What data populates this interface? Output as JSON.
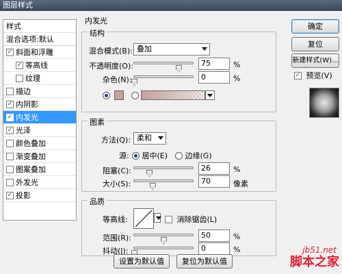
{
  "window": {
    "title": "图层样式"
  },
  "sidebar": {
    "header": "样式",
    "items": [
      {
        "label": "混合选项:默认",
        "check": false,
        "hasCheck": false
      },
      {
        "label": "斜面和浮雕",
        "check": true,
        "hasCheck": true
      },
      {
        "label": "等高线",
        "check": true,
        "hasCheck": true,
        "indent": true
      },
      {
        "label": "纹理",
        "check": false,
        "hasCheck": true,
        "indent": true
      },
      {
        "label": "描边",
        "check": false,
        "hasCheck": true
      },
      {
        "label": "内阴影",
        "check": true,
        "hasCheck": true
      },
      {
        "label": "内发光",
        "check": true,
        "hasCheck": true,
        "selected": true
      },
      {
        "label": "光泽",
        "check": true,
        "hasCheck": true
      },
      {
        "label": "颜色叠加",
        "check": false,
        "hasCheck": true
      },
      {
        "label": "渐变叠加",
        "check": false,
        "hasCheck": true
      },
      {
        "label": "图案叠加",
        "check": false,
        "hasCheck": true
      },
      {
        "label": "外发光",
        "check": false,
        "hasCheck": true
      },
      {
        "label": "投影",
        "check": true,
        "hasCheck": true
      }
    ]
  },
  "main": {
    "section_title": "内发光",
    "structure": {
      "title": "结构",
      "blend_mode_label": "混合模式(B):",
      "blend_mode_value": "叠加",
      "opacity_label": "不透明度(O):",
      "opacity_value": "75",
      "opacity_unit": "%",
      "noise_label": "杂色(N):",
      "noise_value": "0",
      "noise_unit": "%",
      "color_swatch": "#c8a09a"
    },
    "elements": {
      "title": "图素",
      "method_label": "方法(Q):",
      "method_value": "柔和",
      "source_label": "源:",
      "source_center": "居中(E)",
      "source_edge": "边缘(G)",
      "choke_label": "阻塞(C):",
      "choke_value": "26",
      "choke_unit": "%",
      "size_label": "大小(S):",
      "size_value": "70",
      "size_unit": "像素"
    },
    "quality": {
      "title": "品质",
      "contour_label": "等高线:",
      "antialias_label": "消除锯齿(L)",
      "range_label": "范围(R):",
      "range_value": "50",
      "range_unit": "%",
      "jitter_label": "抖动(J):",
      "jitter_value": "0",
      "jitter_unit": "%"
    },
    "btn_set_default": "设置为默认值",
    "btn_reset_default": "复位为默认值"
  },
  "right": {
    "ok": "确定",
    "reset": "复位",
    "new_style": "新建样式(W)...",
    "preview_label": "预览(V)",
    "preview_checked": true
  },
  "watermark": {
    "line1": "jb51.net",
    "line2": "脚本之家"
  }
}
